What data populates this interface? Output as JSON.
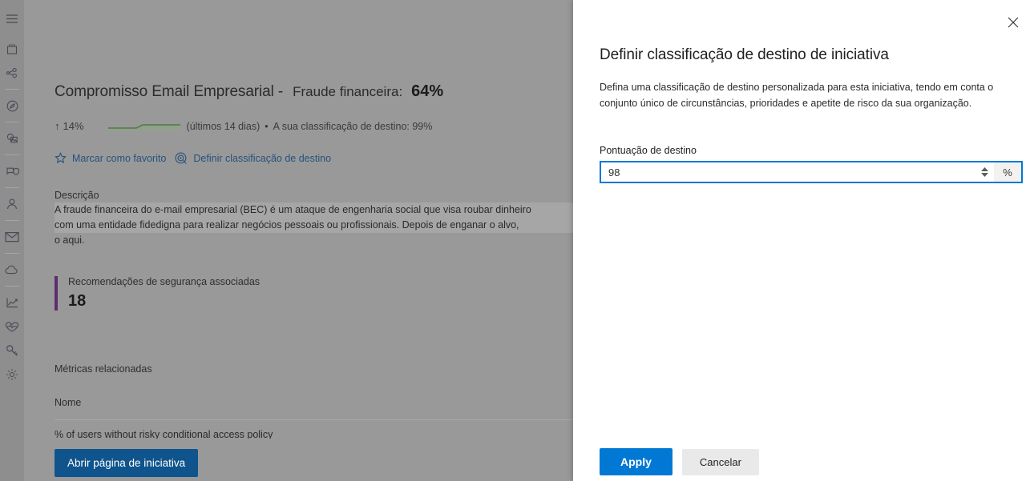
{
  "sidebar": {
    "items": [
      {
        "name": "hamburger-menu-icon",
        "label": "Menu"
      },
      {
        "name": "home-icon",
        "label": "Início"
      },
      {
        "name": "share-nodes-icon",
        "label": "Incidentes"
      },
      {
        "name": "compass-icon",
        "label": "Caça"
      },
      {
        "name": "image-shapes-icon",
        "label": "Centro de ações"
      },
      {
        "name": "shield-device-icon",
        "label": "Ameaças"
      },
      {
        "name": "person-icon",
        "label": "Utilizadores"
      },
      {
        "name": "mail-icon",
        "label": "Email e colaboração"
      },
      {
        "name": "cloud-icon",
        "label": "Aplicações na cloud"
      },
      {
        "name": "chart-line-icon",
        "label": "Relatórios"
      },
      {
        "name": "heartbeat-icon",
        "label": "Estado de funcionamento"
      },
      {
        "name": "key-icon",
        "label": "Permissões"
      },
      {
        "name": "gear-icon",
        "label": "Definições"
      }
    ]
  },
  "main": {
    "title": "Compromisso Email Empresarial -",
    "subtitle": "Fraude financeira:",
    "score": "64%",
    "trend_arrow": "↑",
    "trend_value": "14%",
    "trend_period": "(últimos 14 dias)",
    "separator": "•",
    "target_text": "A sua classificação de destino: 99%",
    "actions": [
      {
        "icon": "star-icon",
        "label": "Marcar como favorito"
      },
      {
        "icon": "target-icon",
        "label": "Definir classificação de destino"
      }
    ],
    "description_label": "Descrição",
    "description_line1": "A fraude financeira do e-mail empresarial (BEC) é um ataque de engenharia social que visa roubar dinheiro",
    "description_line2": "com uma entidade fidedigna para realizar negócios pessoais ou profissionais. Depois de enganar o alvo,",
    "description_line3": "o aqui.",
    "recommendations_label": "Recomendações de segurança associadas",
    "recommendations_count": "18",
    "metrics_label": "Métricas relacionadas",
    "metrics_column_header": "Nome",
    "metrics_first_row": "% of users without risky conditional access policy",
    "open_button": "Abrir página de iniciativa"
  },
  "panel": {
    "close_label": "Fechar",
    "title": "Definir classificação de destino de iniciativa",
    "description_line1": "Defina uma classificação de destino personalizada para esta iniciativa, tendo em conta o conjunto único",
    "description_line2": "de circunstâncias, prioridades e apetite de risco da sua organização.",
    "field_label": "Pontuação de destino",
    "field_value": "98",
    "field_suffix": "%",
    "apply_button": "Apply",
    "cancel_button": "Cancelar"
  },
  "colors": {
    "accent_blue": "#0078d4",
    "primary_button_dark": "#0f548c",
    "recommendation_bar": "#5c2e6e",
    "sparkline_green": "#4f7a45",
    "link_blue": "#26527c",
    "overlay_gray": "#999999"
  }
}
